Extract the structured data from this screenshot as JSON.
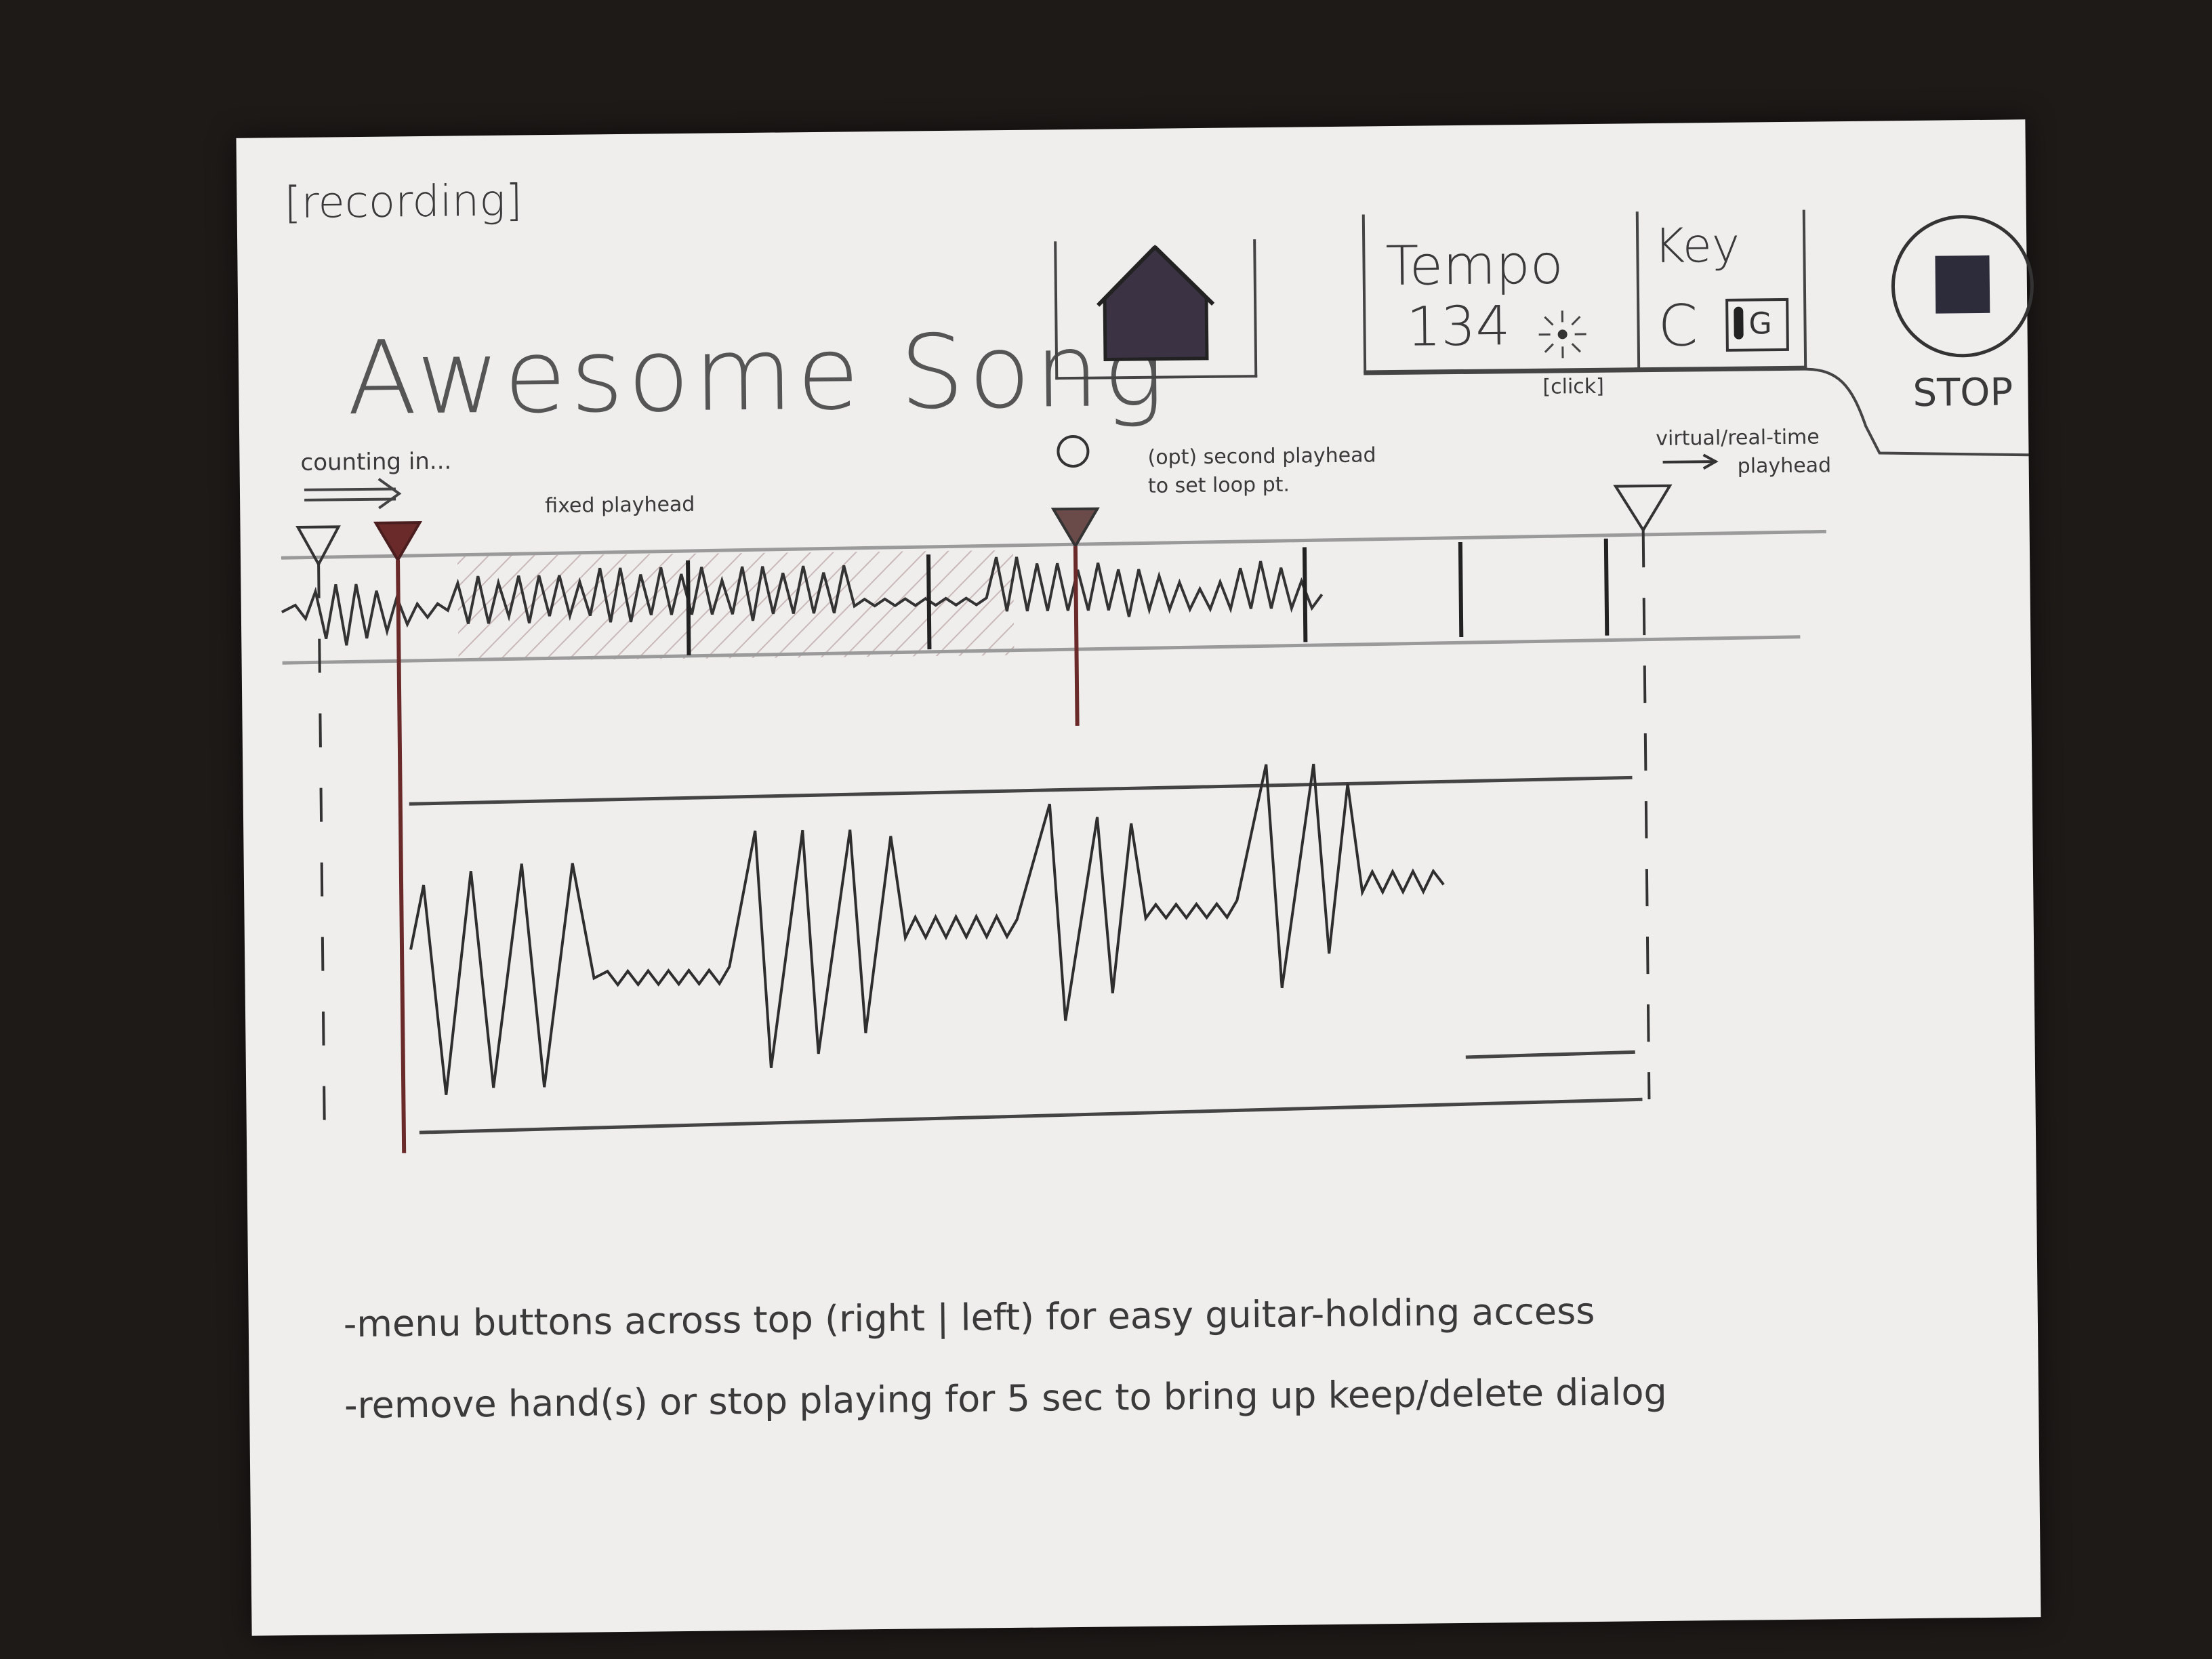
{
  "header": {
    "status_label": "[recording]",
    "song_title": "Awesome Song"
  },
  "toolbar": {
    "home_icon": "home-icon",
    "tempo": {
      "label": "Tempo",
      "value": "134",
      "click_label": "[click]"
    },
    "key": {
      "label": "Key",
      "value": "C",
      "alt_value": "G"
    },
    "stop": {
      "label": "STOP",
      "icon": "stop-icon"
    }
  },
  "playheads": {
    "counting_in_label": "counting in...",
    "fixed_label": "fixed playhead",
    "second_label_line1": "(opt) second playhead",
    "second_label_line2": "to set loop pt.",
    "virtual_label_line1": "virtual/real-time",
    "virtual_label_line2": "playhead"
  },
  "notes": {
    "note_1": "-menu buttons across top (right | left) for easy guitar-holding access",
    "note_2": "-remove hand(s) or stop playing for 5 sec to bring up keep/delete dialog"
  },
  "colors": {
    "paper": "#efeeec",
    "ink": "#3a3a3a",
    "playhead_ink": "#6b2a2a",
    "background": "#1e1a18"
  }
}
